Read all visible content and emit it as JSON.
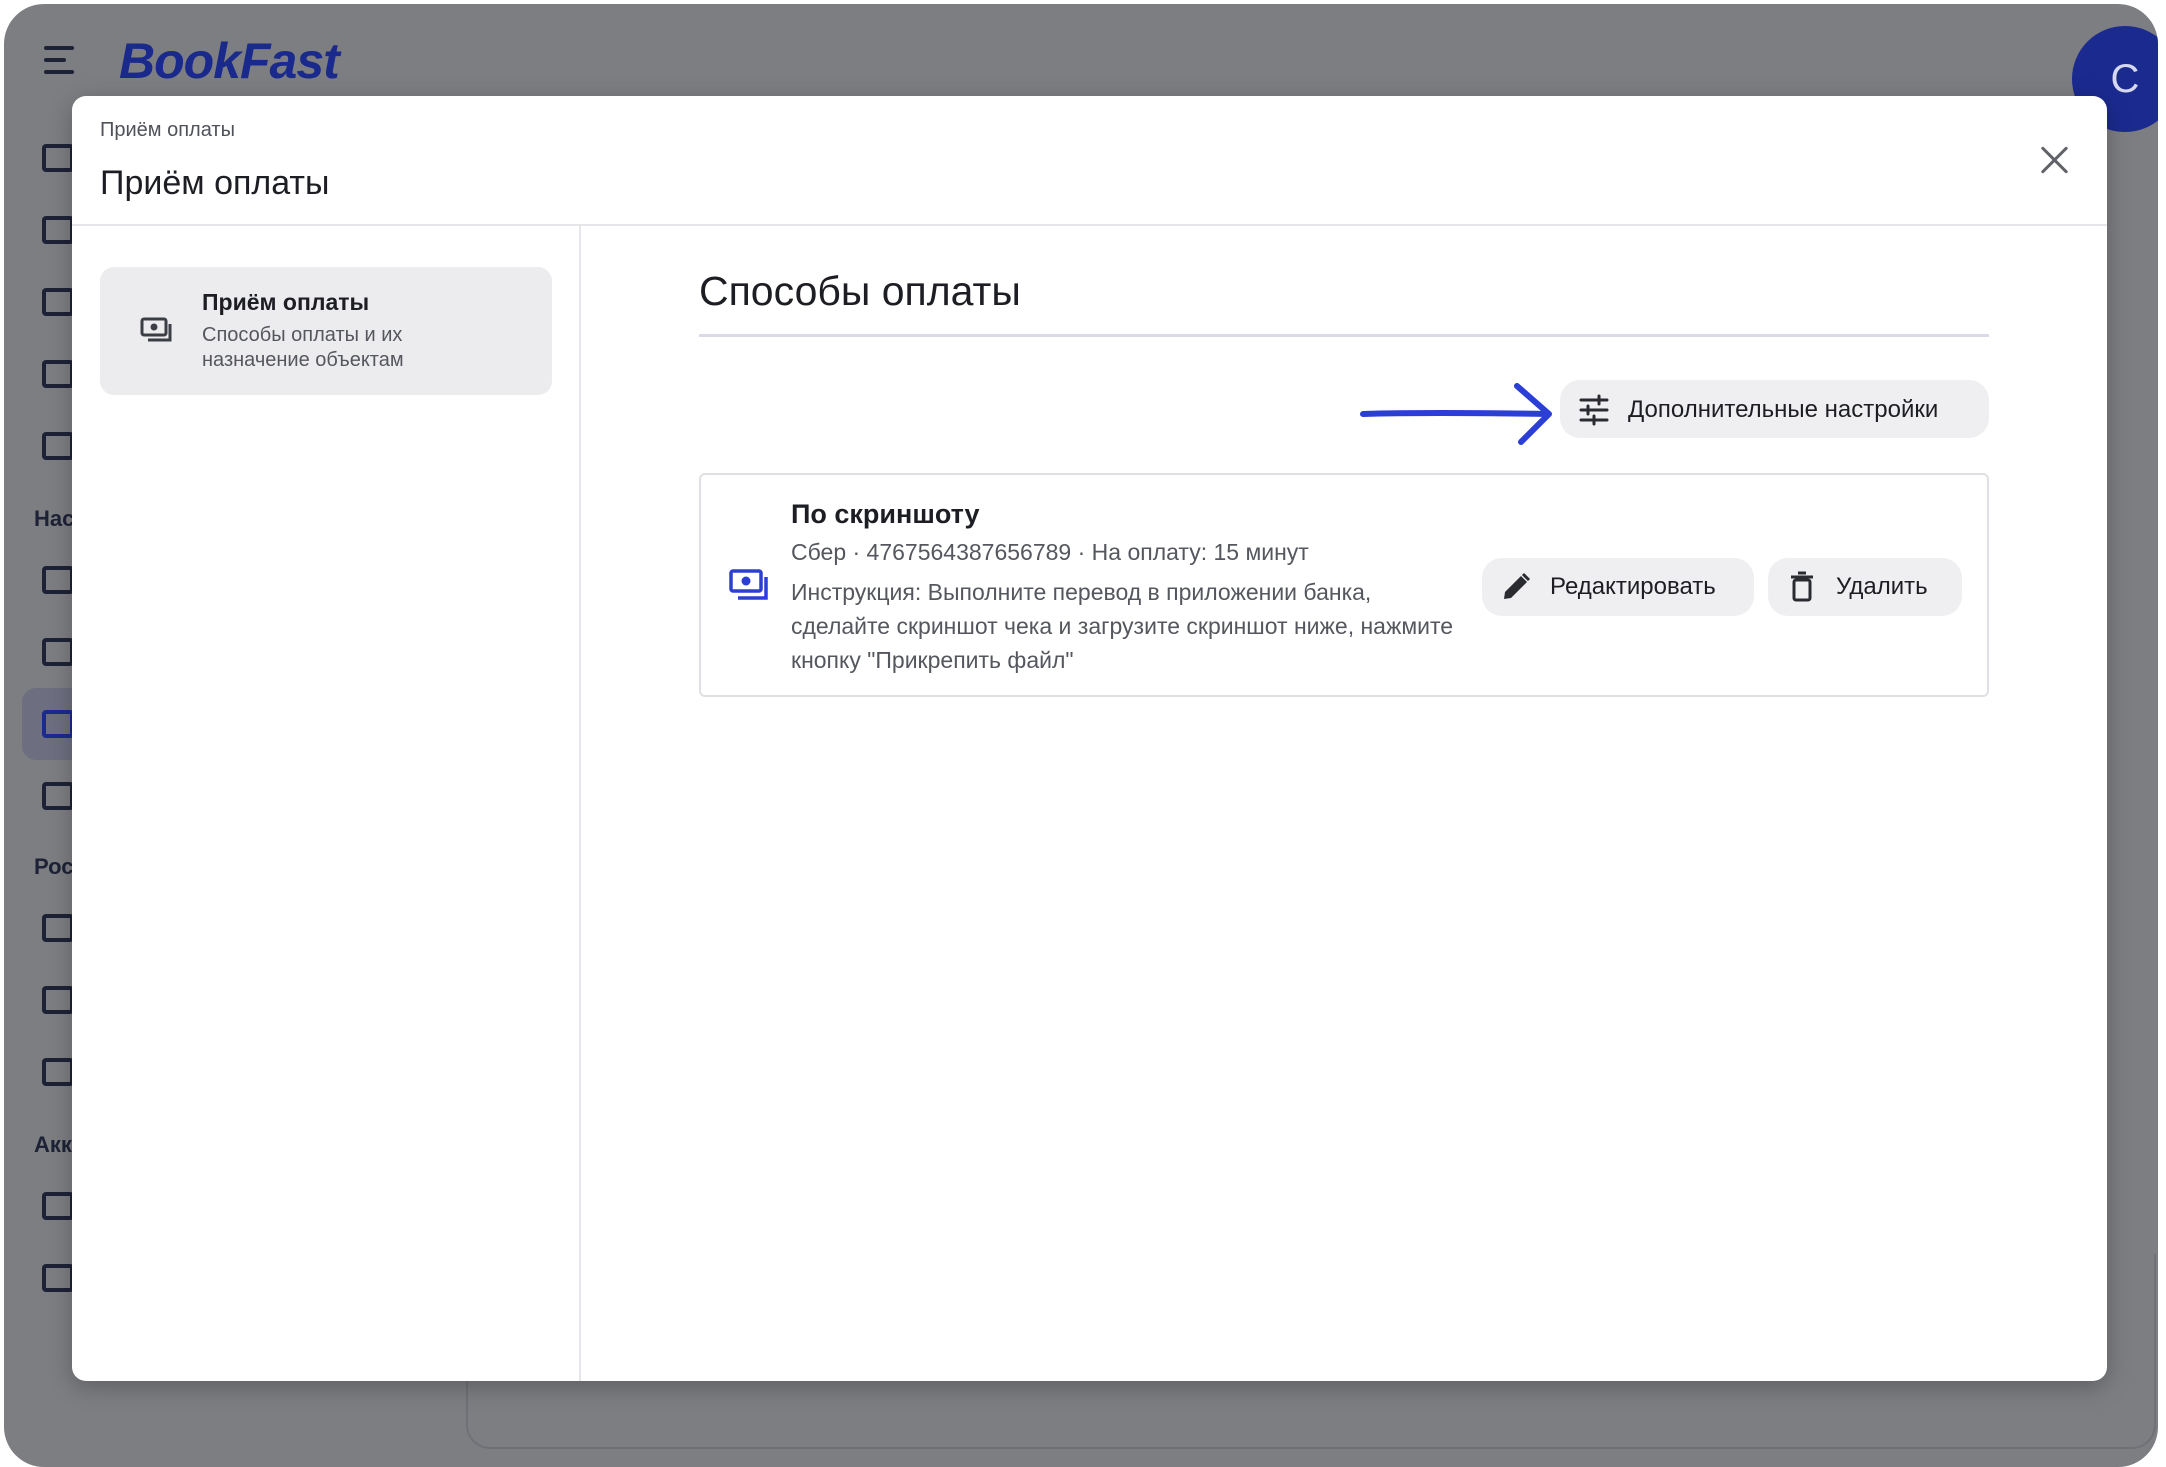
{
  "app": {
    "logo": "BookFast",
    "avatar_letter": "C",
    "sidebar_sections": [
      "Нас",
      "Рос",
      "Акк"
    ]
  },
  "modal": {
    "breadcrumb": "Приём оплаты",
    "title": "Приём оплаты",
    "nav": {
      "title": "Приём оплаты",
      "subtitle": "Способы оплаты и их назначение объектам"
    },
    "section_title": "Способы оплаты",
    "advanced_settings_label": "Дополнительные настройки",
    "payment_method": {
      "name": "По скриншоту",
      "meta": "Сбер · 4767564387656789 · На оплату: 15 минут",
      "instruction": "Инструкция: Выполните перевод в приложении банка, сделайте скриншот чека и загрузите скриншот ниже, нажмите кнопку \"Прикрепить файл\"",
      "edit_label": "Редактировать",
      "delete_label": "Удалить"
    }
  },
  "colors": {
    "accent": "#2b3fd6",
    "brand": "#1a2a8c",
    "overlay": "#7d7e82"
  }
}
